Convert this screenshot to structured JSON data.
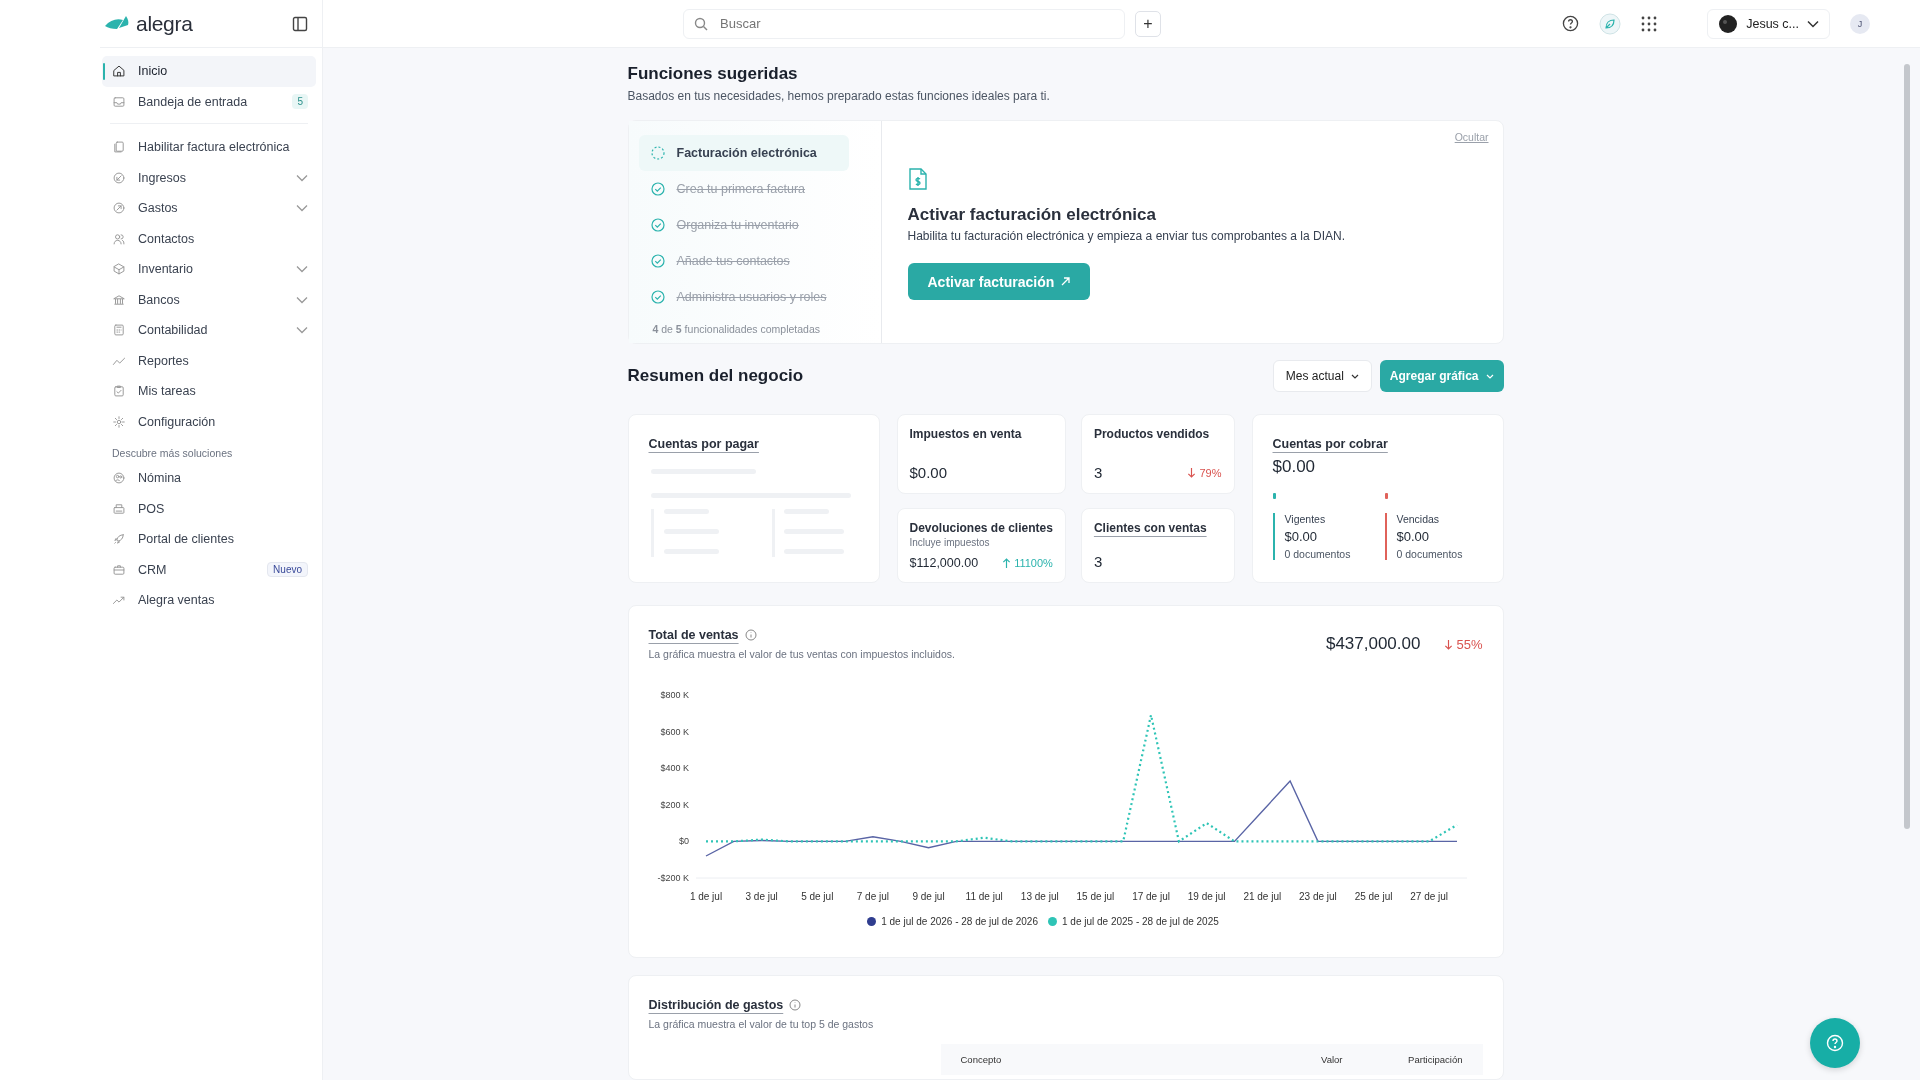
{
  "sidebar": {
    "logo": "alegra",
    "items": [
      {
        "label": "Inicio",
        "selected": true,
        "expandable": false
      },
      {
        "label": "Bandeja de entrada",
        "selected": false,
        "expandable": false,
        "badge": "5"
      },
      {
        "label": "Habilitar factura electrónica",
        "selected": false,
        "expandable": false
      },
      {
        "label": "Ingresos",
        "selected": false,
        "expandable": true
      },
      {
        "label": "Gastos",
        "selected": false,
        "expandable": true
      },
      {
        "label": "Contactos",
        "selected": false,
        "expandable": false
      },
      {
        "label": "Inventario",
        "selected": false,
        "expandable": true
      },
      {
        "label": "Bancos",
        "selected": false,
        "expandable": true
      },
      {
        "label": "Contabilidad",
        "selected": false,
        "expandable": true
      },
      {
        "label": "Reportes",
        "selected": false,
        "expandable": false
      },
      {
        "label": "Mis tareas",
        "selected": false,
        "expandable": false
      },
      {
        "label": "Configuración",
        "selected": false,
        "expandable": false
      }
    ],
    "section_title": "Descubre más soluciones",
    "solutions": [
      {
        "label": "Nómina"
      },
      {
        "label": "POS"
      },
      {
        "label": "Portal de clientes"
      },
      {
        "label": "CRM",
        "tag": "Nuevo"
      },
      {
        "label": "Alegra ventas"
      }
    ]
  },
  "header": {
    "search": {
      "placeholder": "Buscar"
    },
    "add_button": "+",
    "user": {
      "name": "Jesus c...",
      "initial": "J"
    }
  },
  "suggested": {
    "title": "Funciones sugeridas",
    "subtitle": "Basados en tus necesidades, hemos preparado estas funciones ideales para ti.",
    "steps": [
      {
        "label": "Facturación electrónica",
        "done": false,
        "selected": true
      },
      {
        "label": "Crea tu primera factura",
        "done": true,
        "selected": false
      },
      {
        "label": "Organiza tu inventario",
        "done": true,
        "selected": false
      },
      {
        "label": "Añade tus contactos",
        "done": true,
        "selected": false
      },
      {
        "label": "Administra usuarios y roles",
        "done": true,
        "selected": false
      }
    ],
    "progress": "**4** de **5** funcionalidades completadas",
    "hide_link": "Ocultar",
    "feature": {
      "title": "Activar facturación electrónica",
      "description": "Habilita tu facturación electrónica y empieza a enviar tus comprobantes a la DIAN.",
      "button": "Activar facturación"
    }
  },
  "summary": {
    "title": "Resumen del negocio",
    "period_button": "Mes actual",
    "add_chart_button": "Agregar gráfica",
    "payables": {
      "title": "Cuentas por pagar"
    },
    "cards": [
      {
        "title": "Impuestos en venta",
        "value": "$0.00"
      },
      {
        "title": "Productos vendidos",
        "value": "3",
        "change": {
          "text": "79%",
          "increase": false
        }
      },
      {
        "title": "Devoluciones de clientes",
        "note": "Incluye impuestos",
        "value": "$112,000.00",
        "change": {
          "text": "11100%",
          "increase": true
        }
      },
      {
        "title": "Clientes con ventas",
        "value": "3",
        "link": true
      }
    ],
    "receivables": {
      "title": "Cuentas por cobrar",
      "value": "$0.00",
      "groups": [
        {
          "label": "Vigentes",
          "value": "$0.00",
          "documents": "0 documentos",
          "color": "#2bb3ad"
        },
        {
          "label": "Vencidas",
          "value": "$0.00",
          "documents": "0 documentos",
          "color": "#e0625a"
        }
      ]
    }
  },
  "sales": {
    "title": "Total de ventas",
    "subtitle": "La gráfica muestra el valor de tus ventas con impuestos incluidos.",
    "total": "$437,000.00",
    "change": {
      "text": "55%",
      "increase": false
    },
    "chart_data": {
      "type": "line",
      "categories": [
        "1 de jul",
        null,
        "3 de jul",
        null,
        "5 de jul",
        null,
        "7 de jul",
        null,
        "9 de jul",
        null,
        "11 de jul",
        null,
        "13 de jul",
        null,
        "15 de jul",
        null,
        "17 de jul",
        null,
        "19 de jul",
        null,
        "21 de jul",
        null,
        "23 de jul",
        null,
        "25 de jul",
        null,
        "27 de jul",
        null
      ],
      "series": [
        {
          "name": "1 de jul de 2026 - 28 de jul de 2026",
          "color": "#2f3d8f",
          "line_style": "solid",
          "values": [
            -80,
            0,
            5,
            0,
            0,
            0,
            25,
            0,
            -35,
            0,
            0,
            0,
            0,
            0,
            0,
            0,
            0,
            0,
            0,
            0,
            165,
            330,
            0,
            0,
            0,
            0,
            0,
            0
          ]
        },
        {
          "name": "1 de jul de 2025 - 28 de jul de 2025",
          "color": "#2ec4b6",
          "line_style": "dotted",
          "values": [
            0,
            0,
            10,
            0,
            0,
            0,
            0,
            0,
            0,
            0,
            20,
            0,
            0,
            0,
            0,
            0,
            690,
            0,
            100,
            0,
            0,
            0,
            0,
            0,
            0,
            0,
            0,
            90
          ]
        }
      ],
      "ylim": [
        -200,
        800
      ],
      "legend": "bottom",
      "yticks": [
        {
          "value": -200,
          "label": "-$200 K"
        },
        {
          "value": 0,
          "label": "$0"
        },
        {
          "value": 200,
          "label": "$200 K"
        },
        {
          "value": 400,
          "label": "$400 K"
        },
        {
          "value": 600,
          "label": "$600 K"
        },
        {
          "value": 800,
          "label": "$800 K"
        }
      ]
    }
  },
  "expenses": {
    "title": "Distribución de gastos",
    "subtitle": "La gráfica muestra el valor de tu top 5 de gastos",
    "columns": [
      "Concepto",
      "Valor",
      "Participación"
    ]
  }
}
